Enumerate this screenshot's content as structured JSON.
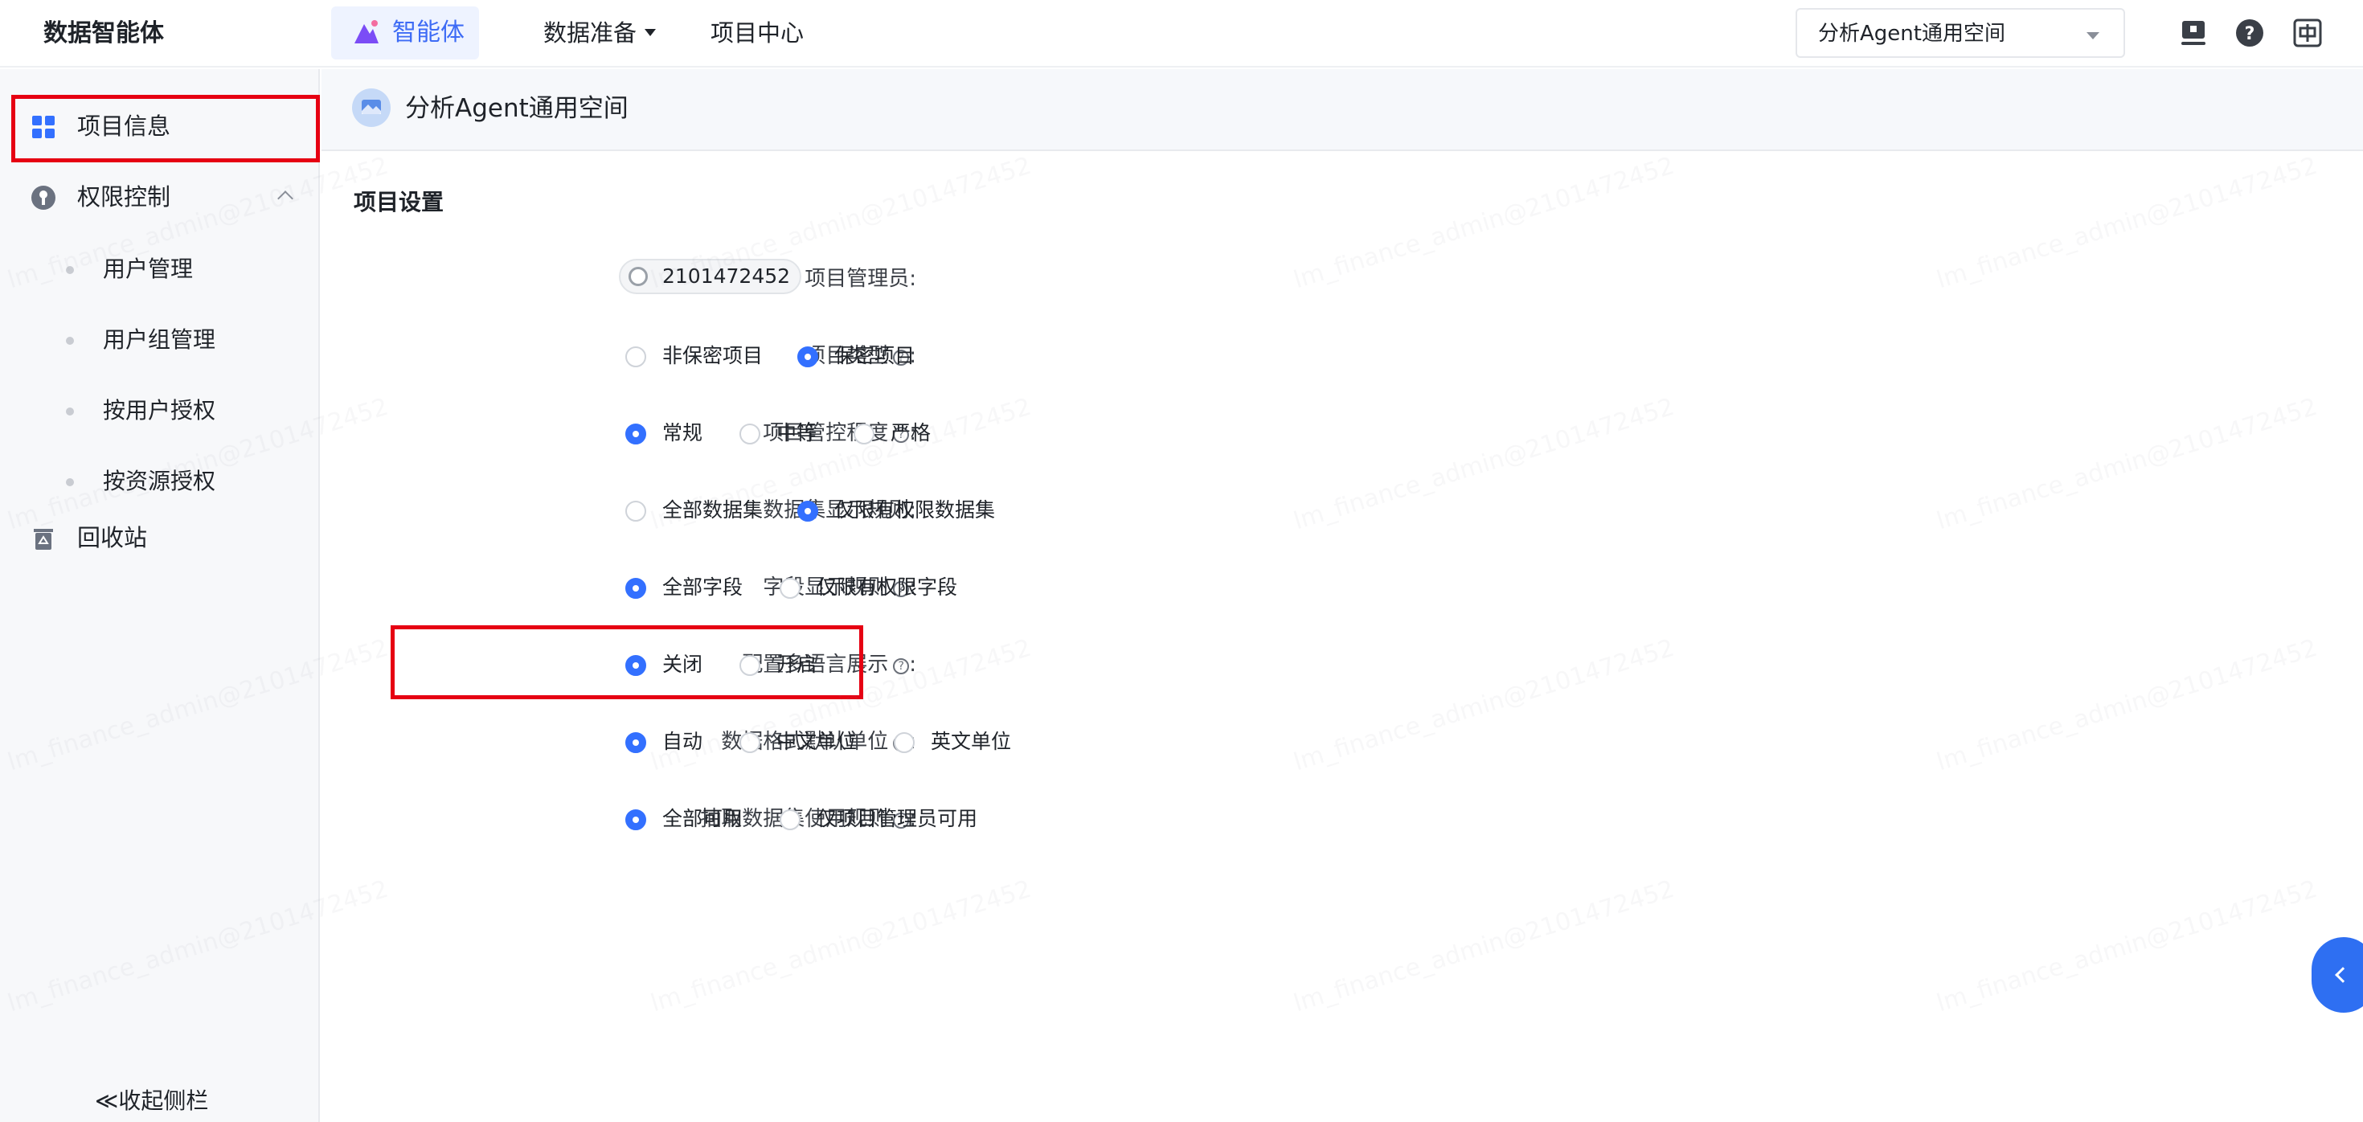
{
  "topbar": {
    "brand": "数据智能体",
    "nav": [
      {
        "label": "智能体",
        "active": true
      },
      {
        "label": "数据准备",
        "has_dropdown": true
      },
      {
        "label": "项目中心"
      }
    ],
    "space_selector": {
      "value": "分析Agent通用空间"
    },
    "icons": [
      "monitor-icon",
      "help-icon",
      "language-icon"
    ]
  },
  "sidebar": {
    "items": [
      {
        "label": "项目信息",
        "icon": "grid-icon",
        "selected": true
      },
      {
        "label": "权限控制",
        "icon": "key-icon",
        "expanded": true,
        "children": [
          "用户管理",
          "用户组管理",
          "按用户授权",
          "按资源授权"
        ]
      },
      {
        "label": "回收站",
        "icon": "recycle-bin-icon"
      }
    ],
    "collapse_label": "≪收起侧栏"
  },
  "main": {
    "header_title": "分析Agent通用空间",
    "section_title": "项目设置",
    "admin": {
      "label": "项目管理员:",
      "value": "2101472452"
    },
    "settings": [
      {
        "label": "项目类型",
        "options": [
          "非保密项目",
          "保密项目"
        ],
        "selected": 1
      },
      {
        "label": "项目管控程度",
        "options": [
          "常规",
          "中等",
          "严格"
        ],
        "selected": 0
      },
      {
        "label": "数据集显示规则:",
        "options": [
          "全部数据集",
          "仅限有权限数据集"
        ],
        "selected": 1
      },
      {
        "label": "字段显示规则",
        "options": [
          "全部字段",
          "仅限有权限字段"
        ],
        "selected": 0
      },
      {
        "label": "配置多语言展示",
        "options": [
          "关闭",
          "开启"
        ],
        "selected": 0
      },
      {
        "label": "数据格式默认单位",
        "options": [
          "自动",
          "中文单位",
          "英文单位"
        ],
        "selected": 0
      },
      {
        "label": "抽取数据集使用规则",
        "options": [
          "全部可用",
          "仅项目管理员可用"
        ],
        "selected": 0
      }
    ]
  },
  "watermark_text": "lm_finance_admin@2101472452",
  "colors": {
    "accent": "#3370ff",
    "highlight": "#e60012"
  }
}
